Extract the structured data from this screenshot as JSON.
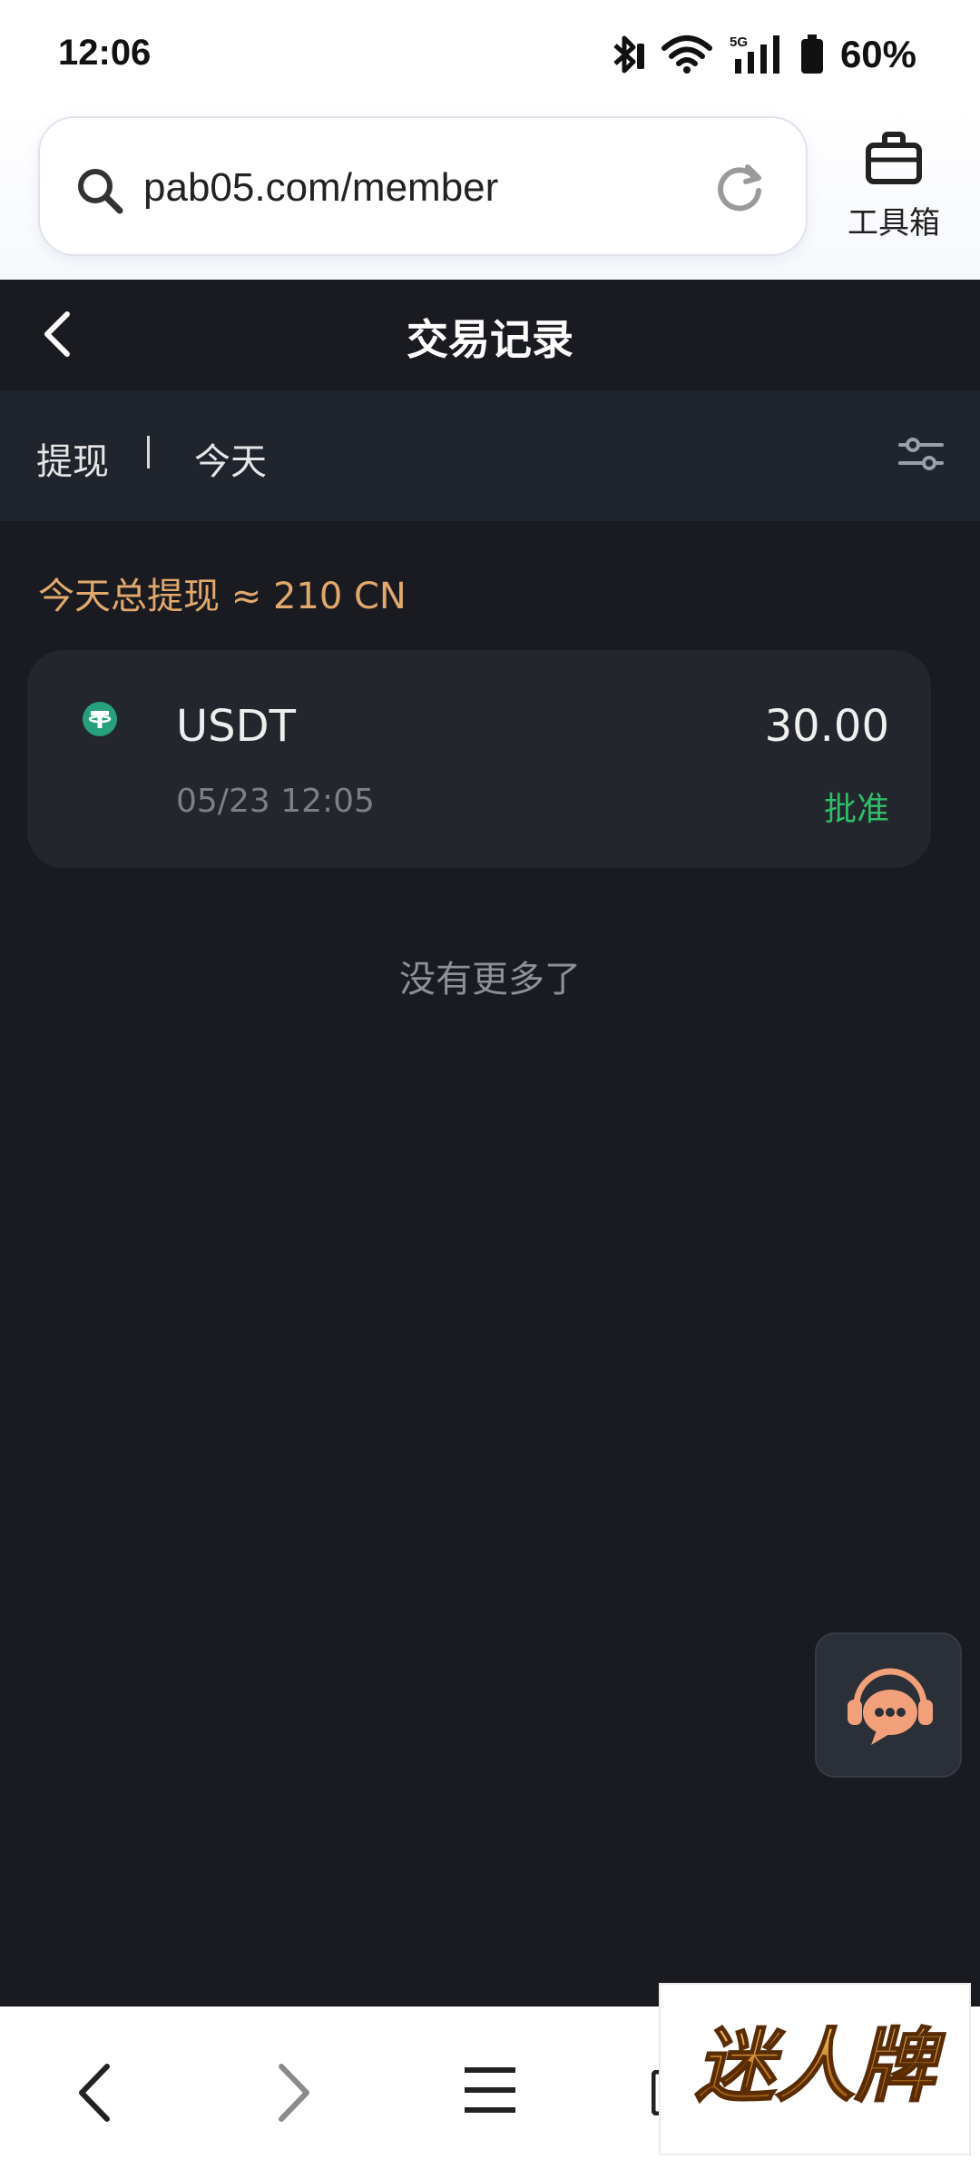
{
  "status_bar": {
    "time": "12:06",
    "battery_percent": "60%",
    "network": "5G"
  },
  "browser": {
    "url": "pab05.com/member",
    "toolbox_label": "工具箱"
  },
  "header": {
    "title": "交易记录"
  },
  "filter": {
    "type_label": "提现",
    "date_label": "今天"
  },
  "summary": {
    "text": "今天总提现 ≈ 210 CN"
  },
  "records": [
    {
      "coin": "USDT",
      "datetime": "05/23 12:05",
      "amount": "30.00",
      "status": "批准"
    }
  ],
  "list_footer": "没有更多了",
  "brand": {
    "logo_text": "迷人牌"
  },
  "colors": {
    "page_bg": "#1a1b20",
    "filter_bg": "#20242d",
    "card_bg": "#24262d",
    "accent_orange": "#e2a86d",
    "status_green": "#2fbf6a",
    "coin_teal": "#26a17b"
  }
}
